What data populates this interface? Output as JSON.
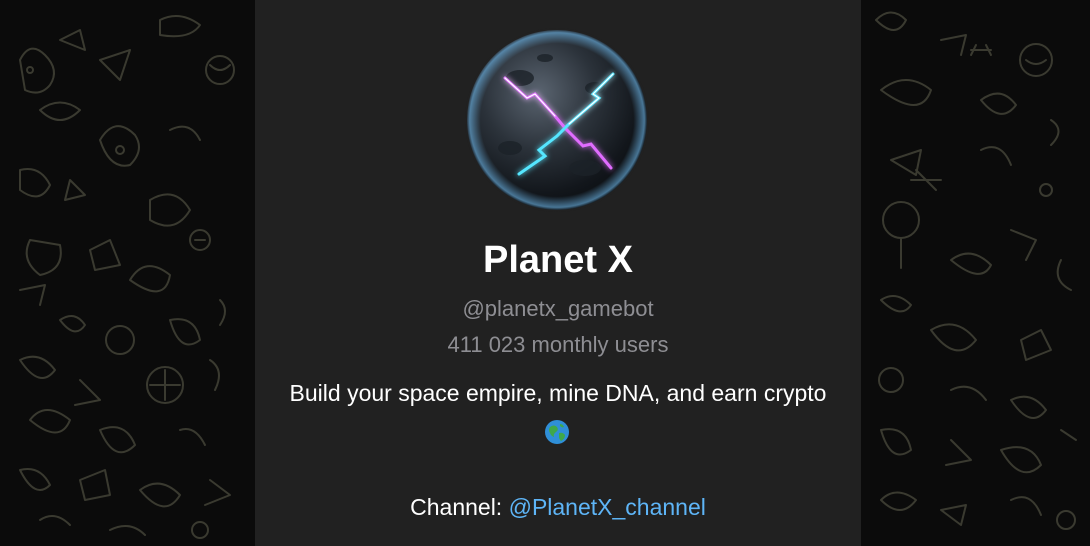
{
  "bot": {
    "name": "Planet X",
    "username": "@planetx_gamebot",
    "monthly_users": "411 023 monthly users",
    "description": "Build your space empire, mine DNA, and earn crypto",
    "description_emoji": "🌍",
    "channel_label": "Channel:",
    "channel_link": "@PlanetX_channel"
  },
  "colors": {
    "card_background": "#212121",
    "page_background": "#0b0b0b",
    "muted_text": "#8e8e93",
    "link": "#5eb5f7"
  },
  "icons": {
    "avatar": "planet-x-avatar",
    "globe": "globe-icon",
    "background": "doodle-pattern"
  }
}
